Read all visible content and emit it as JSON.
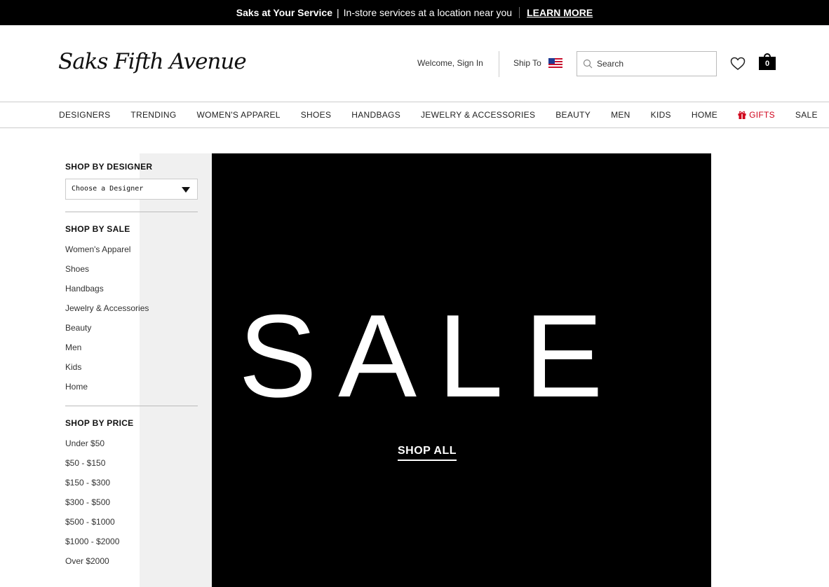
{
  "promo": {
    "brand_text": "Saks at Your Service",
    "separator": "|",
    "message": "In-store services at a location near you",
    "link_label": "LEARN MORE"
  },
  "header": {
    "logo_text": "Saks Fifth Avenue",
    "signin_label": "Welcome, Sign In",
    "shipto_label": "Ship To",
    "search_placeholder": "Search",
    "bag_count": "0"
  },
  "nav": {
    "items": [
      "DESIGNERS",
      "TRENDING",
      "WOMEN'S APPAREL",
      "SHOES",
      "HANDBAGS",
      "JEWELRY & ACCESSORIES",
      "BEAUTY",
      "MEN",
      "KIDS",
      "HOME",
      "GIFTS",
      "SALE"
    ]
  },
  "sidebar": {
    "designer": {
      "heading": "SHOP BY DESIGNER",
      "select_value": "Choose a Designer"
    },
    "sale": {
      "heading": "SHOP BY SALE",
      "links": [
        "Women's Apparel",
        "Shoes",
        "Handbags",
        "Jewelry & Accessories",
        "Beauty",
        "Men",
        "Kids",
        "Home"
      ]
    },
    "price": {
      "heading": "SHOP BY PRICE",
      "links": [
        "Under $50",
        "$50 - $150",
        "$150 - $300",
        "$300 - $500",
        "$500 - $1000",
        "$1000 - $2000",
        "Over $2000"
      ]
    }
  },
  "hero": {
    "title": "SALE",
    "cta_label": "SHOP ALL"
  },
  "colors": {
    "gifts_red": "#d0021b",
    "hero_bg": "#000000",
    "sidebar_gray": "#f0f0f0"
  }
}
